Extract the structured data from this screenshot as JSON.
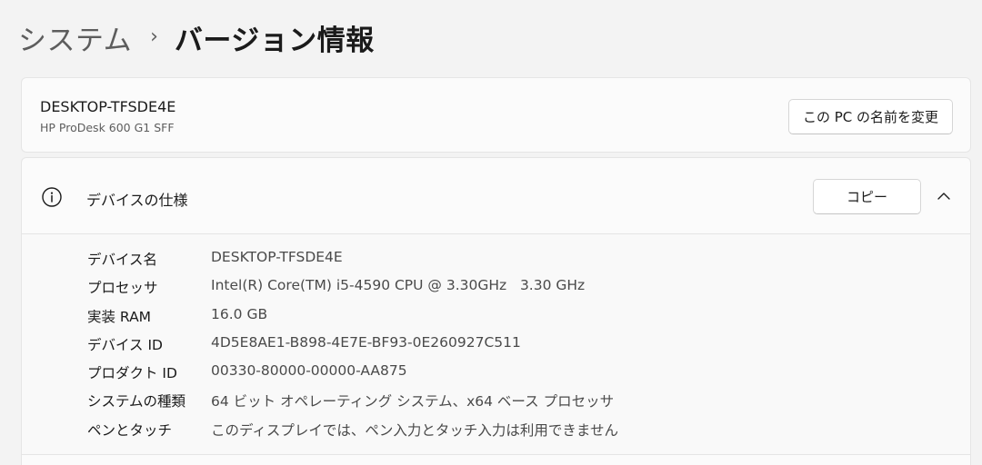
{
  "breadcrumb": {
    "parent": "システム",
    "separator": "›",
    "current": "バージョン情報"
  },
  "device": {
    "name": "DESKTOP-TFSDE4E",
    "model": "HP ProDesk 600 G1 SFF",
    "rename_button": "この PC の名前を変更"
  },
  "specs": {
    "title": "デバイスの仕様",
    "copy_button": "コピー",
    "icon": "info-icon",
    "collapse_icon": "chevron-up-icon",
    "rows": [
      {
        "label": "デバイス名",
        "value": "DESKTOP-TFSDE4E"
      },
      {
        "label": "プロセッサ",
        "value": "Intel(R) Core(TM) i5-4590 CPU @ 3.30GHz   3.30 GHz"
      },
      {
        "label": "実装 RAM",
        "value": "16.0 GB"
      },
      {
        "label": "デバイス ID",
        "value": "4D5E8AE1-B898-4E7E-BF93-0E260927C511"
      },
      {
        "label": "プロダクト ID",
        "value": "00330-80000-00000-AA875"
      },
      {
        "label": "システムの種類",
        "value": "64 ビット オペレーティング システム、x64 ベース プロセッサ"
      },
      {
        "label": "ペンとタッチ",
        "value": "このディスプレイでは、ペン入力とタッチ入力は利用できません"
      }
    ]
  }
}
